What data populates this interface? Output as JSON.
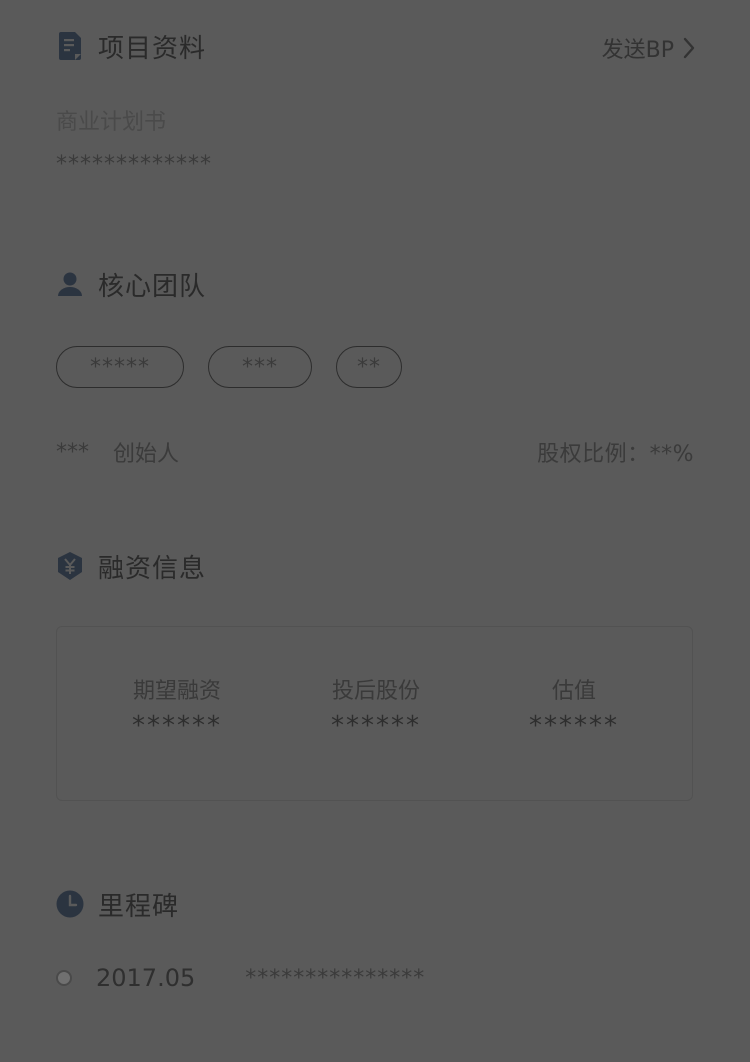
{
  "project_info": {
    "title": "项目资料",
    "icon": "document-icon",
    "send_bp_label": "发送BP",
    "bp_label": "商业计划书",
    "bp_value": "*************"
  },
  "team": {
    "title": "核心团队",
    "icon": "person-icon",
    "chips": [
      "*****",
      "***",
      "**"
    ],
    "member_name": "***",
    "member_role": "创始人",
    "equity_text": "股权比例：**%"
  },
  "financing": {
    "title": "融资信息",
    "icon": "yen-shield-icon",
    "items": [
      {
        "label": "期望融资",
        "value": "******"
      },
      {
        "label": "投后股份",
        "value": "******"
      },
      {
        "label": "估值",
        "value": "******"
      }
    ]
  },
  "milestone": {
    "title": "里程碑",
    "icon": "clock-icon",
    "date": "2017.05",
    "desc": "***************"
  },
  "colors": {
    "overlay_bg": "#5a5a5a",
    "text_dark": "#2a2a2a",
    "icon": "#2b3440"
  }
}
